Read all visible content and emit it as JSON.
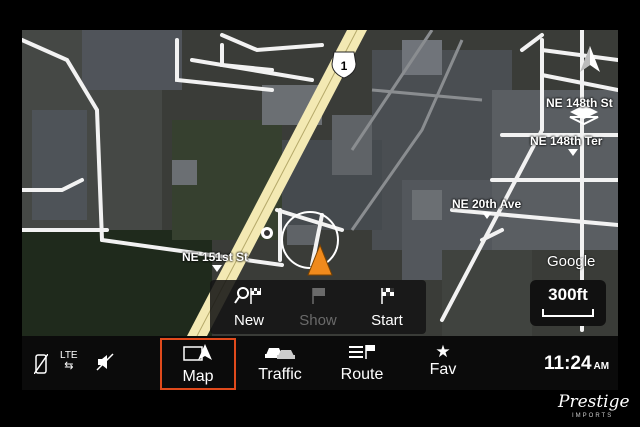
{
  "map": {
    "route_badge": "1",
    "streets": {
      "ne148th_st": "NE 148th St",
      "ne148th_ter": "NE 148th Ter",
      "ne20th_ave": "NE 20th Ave",
      "ne151st_st": "NE 151st St"
    },
    "google_label": "Google",
    "scale_label": "300ft"
  },
  "popup": {
    "new_label": "New",
    "show_label": "Show",
    "start_label": "Start"
  },
  "bottom_bar": {
    "lte_label": "LTE",
    "nav": {
      "map_label": "Map",
      "traffic_label": "Traffic",
      "route_label": "Route",
      "fav_label": "Fav"
    },
    "clock": {
      "time": "11:24",
      "ampm": "AM"
    }
  },
  "watermark": {
    "brand": "Prestige",
    "sub": "IMPORTS"
  },
  "colors": {
    "active_outline": "#e04a1c",
    "highway": "#f3e9b3",
    "vehicle_arrow": "#f08a1c"
  },
  "icons": [
    "compass-arrow-icon",
    "no-phone-icon",
    "lte-icon",
    "mute-icon",
    "map-icon",
    "traffic-icon",
    "route-icon",
    "fav-star-icon",
    "search-flag-icon",
    "start-flag-icon",
    "layers-icon",
    "poi-icon"
  ]
}
